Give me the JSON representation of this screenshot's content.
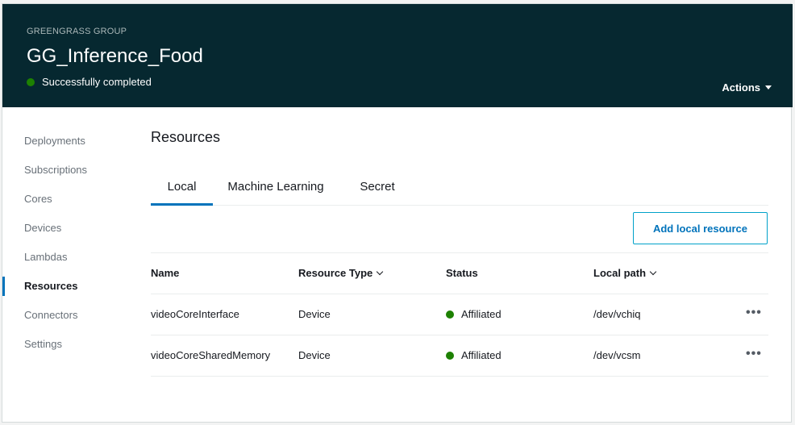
{
  "header": {
    "kicker": "GREENGRASS GROUP",
    "title": "GG_Inference_Food",
    "status": "Successfully completed",
    "status_color": "#1d8102",
    "actions_label": "Actions",
    "background": "#062830"
  },
  "sidebar": {
    "items": [
      {
        "label": "Deployments"
      },
      {
        "label": "Subscriptions"
      },
      {
        "label": "Cores"
      },
      {
        "label": "Devices"
      },
      {
        "label": "Lambdas"
      },
      {
        "label": "Resources",
        "active": true
      },
      {
        "label": "Connectors"
      },
      {
        "label": "Settings"
      }
    ]
  },
  "main": {
    "title": "Resources",
    "tabs": [
      {
        "label": "Local",
        "active": true
      },
      {
        "label": "Machine Learning"
      },
      {
        "label": "Secret"
      }
    ],
    "add_button": "Add local resource",
    "table": {
      "columns": [
        "Name",
        "Resource Type",
        "Status",
        "Local path"
      ],
      "rows": [
        {
          "name": "videoCoreInterface",
          "type": "Device",
          "status": "Affiliated",
          "path": "/dev/vchiq",
          "more": "•••"
        },
        {
          "name": "videoCoreSharedMemory",
          "type": "Device",
          "status": "Affiliated",
          "path": "/dev/vcsm",
          "more": "•••"
        }
      ]
    }
  },
  "colors": {
    "accent": "#0073bb",
    "button_border": "#00a1c9",
    "success": "#1d8102"
  }
}
